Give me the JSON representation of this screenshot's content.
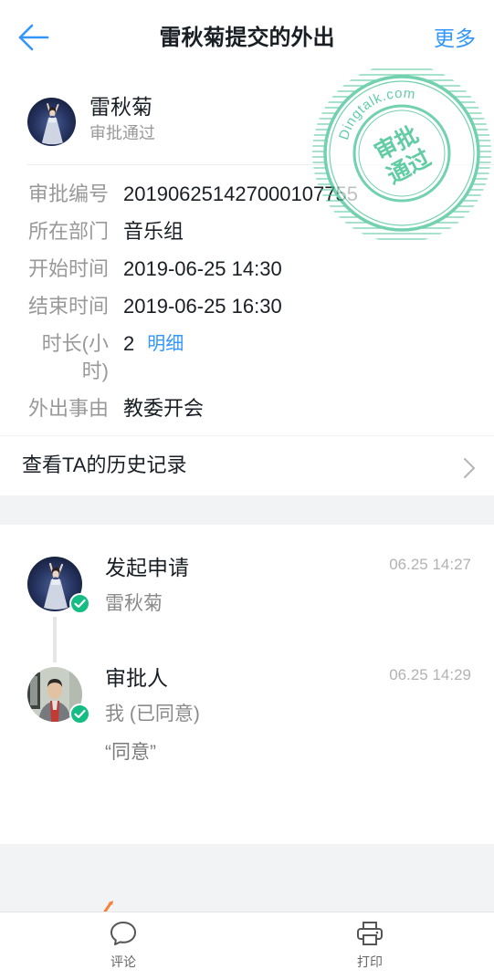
{
  "header": {
    "back_icon": "arrow-left-icon",
    "title": "雷秋菊提交的外出",
    "more_label": "更多"
  },
  "applicant": {
    "name": "雷秋菊",
    "status": "审批通过"
  },
  "stamp": {
    "site": "Dingtalk.com",
    "line1": "审批",
    "line2": "通过"
  },
  "fields": [
    {
      "label": "审批编号",
      "value": "201906251427000107755"
    },
    {
      "label": "所在部门",
      "value": "音乐组"
    },
    {
      "label": "开始时间",
      "value": "2019-06-25 14:30"
    },
    {
      "label": "结束时间",
      "value": "2019-06-25 16:30"
    },
    {
      "label": "时长(小时)",
      "value": "2",
      "link": "明细"
    },
    {
      "label": "外出事由",
      "value": "教委开会"
    }
  ],
  "history": {
    "label": "查看TA的历史记录",
    "icon": "chevron-right-icon"
  },
  "timeline": [
    {
      "title": "发起申请",
      "time": "06.25 14:27",
      "person": "雷秋菊",
      "status_icon": "check-circle-icon"
    },
    {
      "title": "审批人",
      "time": "06.25 14:29",
      "person": "我 (已同意)",
      "comment": "“同意”",
      "status_icon": "check-circle-icon"
    }
  ],
  "toolbar": {
    "comment_label": "评论",
    "comment_icon": "speech-bubble-icon",
    "print_label": "打印",
    "print_icon": "printer-icon"
  },
  "theme": {
    "accent": "#3296fa",
    "approved": "#15bc83",
    "stamp": "#3cc08f",
    "background": "#f2f3f5"
  }
}
